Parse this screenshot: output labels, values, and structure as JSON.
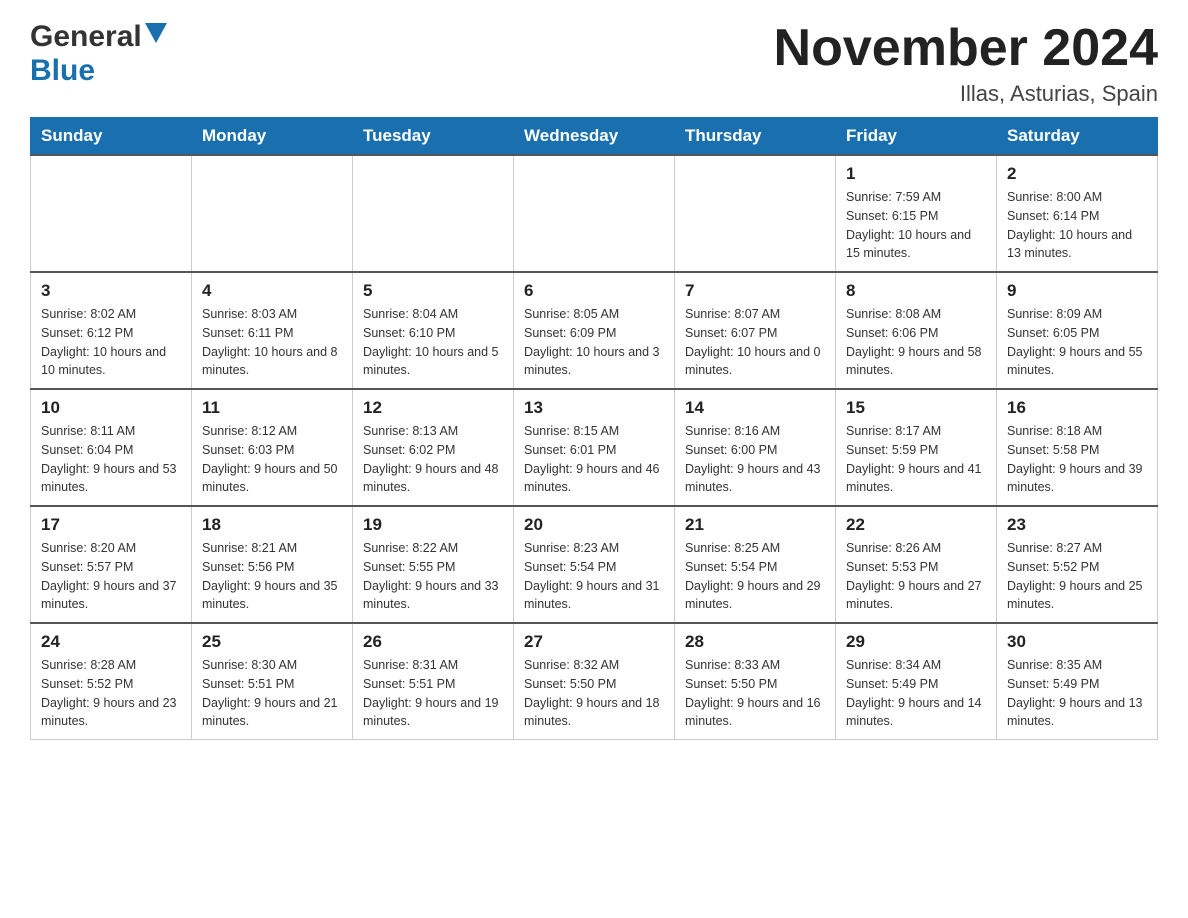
{
  "header": {
    "logo_general": "General",
    "logo_blue": "Blue",
    "title": "November 2024",
    "subtitle": "Illas, Asturias, Spain"
  },
  "calendar": {
    "days_of_week": [
      "Sunday",
      "Monday",
      "Tuesday",
      "Wednesday",
      "Thursday",
      "Friday",
      "Saturday"
    ],
    "weeks": [
      [
        {
          "day": "",
          "sunrise": "",
          "sunset": "",
          "daylight": ""
        },
        {
          "day": "",
          "sunrise": "",
          "sunset": "",
          "daylight": ""
        },
        {
          "day": "",
          "sunrise": "",
          "sunset": "",
          "daylight": ""
        },
        {
          "day": "",
          "sunrise": "",
          "sunset": "",
          "daylight": ""
        },
        {
          "day": "",
          "sunrise": "",
          "sunset": "",
          "daylight": ""
        },
        {
          "day": "1",
          "sunrise": "Sunrise: 7:59 AM",
          "sunset": "Sunset: 6:15 PM",
          "daylight": "Daylight: 10 hours and 15 minutes."
        },
        {
          "day": "2",
          "sunrise": "Sunrise: 8:00 AM",
          "sunset": "Sunset: 6:14 PM",
          "daylight": "Daylight: 10 hours and 13 minutes."
        }
      ],
      [
        {
          "day": "3",
          "sunrise": "Sunrise: 8:02 AM",
          "sunset": "Sunset: 6:12 PM",
          "daylight": "Daylight: 10 hours and 10 minutes."
        },
        {
          "day": "4",
          "sunrise": "Sunrise: 8:03 AM",
          "sunset": "Sunset: 6:11 PM",
          "daylight": "Daylight: 10 hours and 8 minutes."
        },
        {
          "day": "5",
          "sunrise": "Sunrise: 8:04 AM",
          "sunset": "Sunset: 6:10 PM",
          "daylight": "Daylight: 10 hours and 5 minutes."
        },
        {
          "day": "6",
          "sunrise": "Sunrise: 8:05 AM",
          "sunset": "Sunset: 6:09 PM",
          "daylight": "Daylight: 10 hours and 3 minutes."
        },
        {
          "day": "7",
          "sunrise": "Sunrise: 8:07 AM",
          "sunset": "Sunset: 6:07 PM",
          "daylight": "Daylight: 10 hours and 0 minutes."
        },
        {
          "day": "8",
          "sunrise": "Sunrise: 8:08 AM",
          "sunset": "Sunset: 6:06 PM",
          "daylight": "Daylight: 9 hours and 58 minutes."
        },
        {
          "day": "9",
          "sunrise": "Sunrise: 8:09 AM",
          "sunset": "Sunset: 6:05 PM",
          "daylight": "Daylight: 9 hours and 55 minutes."
        }
      ],
      [
        {
          "day": "10",
          "sunrise": "Sunrise: 8:11 AM",
          "sunset": "Sunset: 6:04 PM",
          "daylight": "Daylight: 9 hours and 53 minutes."
        },
        {
          "day": "11",
          "sunrise": "Sunrise: 8:12 AM",
          "sunset": "Sunset: 6:03 PM",
          "daylight": "Daylight: 9 hours and 50 minutes."
        },
        {
          "day": "12",
          "sunrise": "Sunrise: 8:13 AM",
          "sunset": "Sunset: 6:02 PM",
          "daylight": "Daylight: 9 hours and 48 minutes."
        },
        {
          "day": "13",
          "sunrise": "Sunrise: 8:15 AM",
          "sunset": "Sunset: 6:01 PM",
          "daylight": "Daylight: 9 hours and 46 minutes."
        },
        {
          "day": "14",
          "sunrise": "Sunrise: 8:16 AM",
          "sunset": "Sunset: 6:00 PM",
          "daylight": "Daylight: 9 hours and 43 minutes."
        },
        {
          "day": "15",
          "sunrise": "Sunrise: 8:17 AM",
          "sunset": "Sunset: 5:59 PM",
          "daylight": "Daylight: 9 hours and 41 minutes."
        },
        {
          "day": "16",
          "sunrise": "Sunrise: 8:18 AM",
          "sunset": "Sunset: 5:58 PM",
          "daylight": "Daylight: 9 hours and 39 minutes."
        }
      ],
      [
        {
          "day": "17",
          "sunrise": "Sunrise: 8:20 AM",
          "sunset": "Sunset: 5:57 PM",
          "daylight": "Daylight: 9 hours and 37 minutes."
        },
        {
          "day": "18",
          "sunrise": "Sunrise: 8:21 AM",
          "sunset": "Sunset: 5:56 PM",
          "daylight": "Daylight: 9 hours and 35 minutes."
        },
        {
          "day": "19",
          "sunrise": "Sunrise: 8:22 AM",
          "sunset": "Sunset: 5:55 PM",
          "daylight": "Daylight: 9 hours and 33 minutes."
        },
        {
          "day": "20",
          "sunrise": "Sunrise: 8:23 AM",
          "sunset": "Sunset: 5:54 PM",
          "daylight": "Daylight: 9 hours and 31 minutes."
        },
        {
          "day": "21",
          "sunrise": "Sunrise: 8:25 AM",
          "sunset": "Sunset: 5:54 PM",
          "daylight": "Daylight: 9 hours and 29 minutes."
        },
        {
          "day": "22",
          "sunrise": "Sunrise: 8:26 AM",
          "sunset": "Sunset: 5:53 PM",
          "daylight": "Daylight: 9 hours and 27 minutes."
        },
        {
          "day": "23",
          "sunrise": "Sunrise: 8:27 AM",
          "sunset": "Sunset: 5:52 PM",
          "daylight": "Daylight: 9 hours and 25 minutes."
        }
      ],
      [
        {
          "day": "24",
          "sunrise": "Sunrise: 8:28 AM",
          "sunset": "Sunset: 5:52 PM",
          "daylight": "Daylight: 9 hours and 23 minutes."
        },
        {
          "day": "25",
          "sunrise": "Sunrise: 8:30 AM",
          "sunset": "Sunset: 5:51 PM",
          "daylight": "Daylight: 9 hours and 21 minutes."
        },
        {
          "day": "26",
          "sunrise": "Sunrise: 8:31 AM",
          "sunset": "Sunset: 5:51 PM",
          "daylight": "Daylight: 9 hours and 19 minutes."
        },
        {
          "day": "27",
          "sunrise": "Sunrise: 8:32 AM",
          "sunset": "Sunset: 5:50 PM",
          "daylight": "Daylight: 9 hours and 18 minutes."
        },
        {
          "day": "28",
          "sunrise": "Sunrise: 8:33 AM",
          "sunset": "Sunset: 5:50 PM",
          "daylight": "Daylight: 9 hours and 16 minutes."
        },
        {
          "day": "29",
          "sunrise": "Sunrise: 8:34 AM",
          "sunset": "Sunset: 5:49 PM",
          "daylight": "Daylight: 9 hours and 14 minutes."
        },
        {
          "day": "30",
          "sunrise": "Sunrise: 8:35 AM",
          "sunset": "Sunset: 5:49 PM",
          "daylight": "Daylight: 9 hours and 13 minutes."
        }
      ]
    ]
  }
}
